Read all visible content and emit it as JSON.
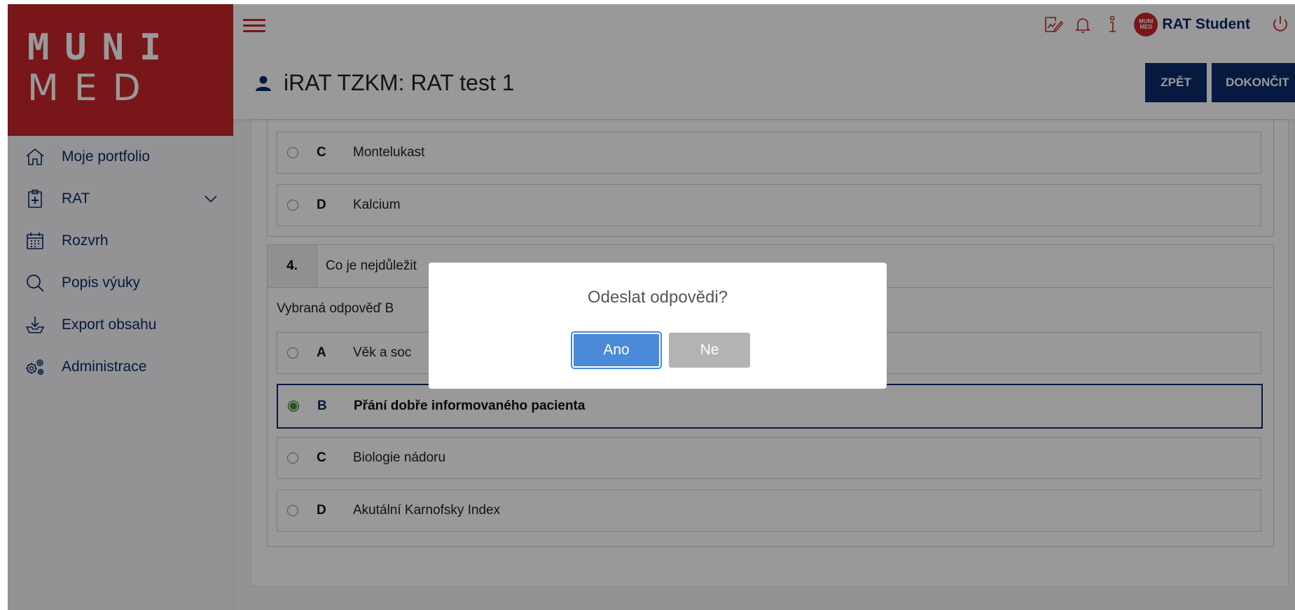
{
  "logo": {
    "line1": "MUNI",
    "line2": "MED"
  },
  "sidebar": {
    "items": [
      {
        "label": "Moje portfolio",
        "icon": "home-icon"
      },
      {
        "label": "RAT",
        "icon": "clipboard-plus-icon"
      },
      {
        "label": "Rozvrh",
        "icon": "calendar-icon"
      },
      {
        "label": "Popis výuky",
        "icon": "search-icon"
      },
      {
        "label": "Export obsahu",
        "icon": "download-tray-icon"
      },
      {
        "label": "Administrace",
        "icon": "gears-icon"
      }
    ]
  },
  "topbar": {
    "icons": [
      "edit-chart-icon",
      "bell-icon",
      "info-icon",
      "avatar",
      "power-icon"
    ],
    "user_name": "RAT Student",
    "avatar_text": "MUNI MED"
  },
  "header": {
    "title": "iRAT TZKM: RAT test 1",
    "back_label": "ZPĚT",
    "finish_label": "DOKONČIT"
  },
  "question3": {
    "options": [
      {
        "letter": "C",
        "text": "Montelukast"
      },
      {
        "letter": "D",
        "text": "Kalcium"
      }
    ]
  },
  "question4": {
    "number": "4.",
    "text": "Co je nejdůležit",
    "chosen": "Vybraná odpověď B",
    "options": [
      {
        "letter": "A",
        "text": "Věk a soc"
      },
      {
        "letter": "B",
        "text": "Přání dobře informovaného pacienta"
      },
      {
        "letter": "C",
        "text": "Biologie nádoru"
      },
      {
        "letter": "D",
        "text": "Akutální Karnofsky Index"
      }
    ]
  },
  "modal": {
    "title": "Odeslat odpovědi?",
    "yes": "Ano",
    "no": "Ne"
  },
  "colors": {
    "brand_red": "#c8252c",
    "navy": "#0b2a6b",
    "primary_blue": "#4a8ad8",
    "grey_button": "#b3b3b3"
  }
}
